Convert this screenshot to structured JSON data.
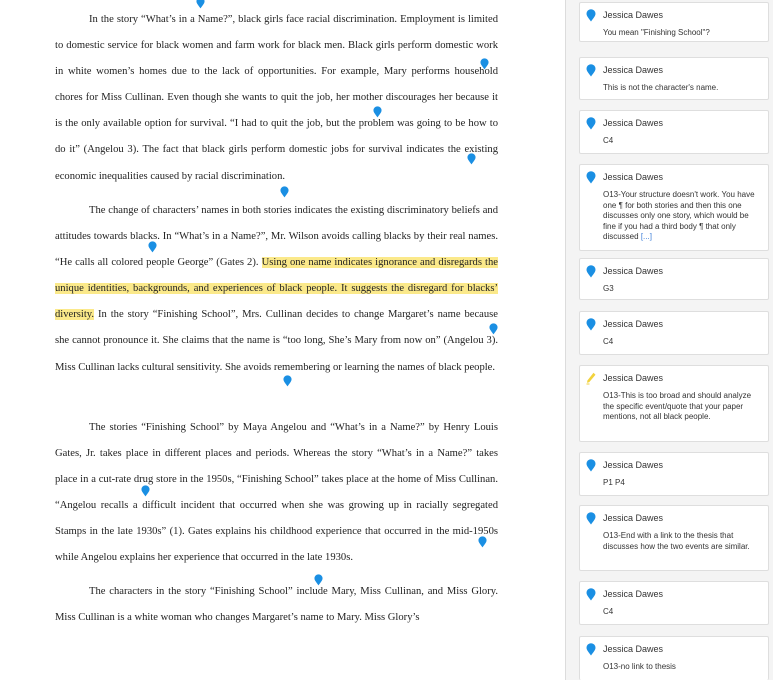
{
  "document": {
    "paragraphs": [
      {
        "text": "In the story “What’s in a Name?”, black girls face racial discrimination. Employment is limited to domestic service for black women and farm work for black men. Black girls perform domestic work in white women’s homes due to the lack of opportunities. For example, Mary performs household chores for Miss Cullinan. Even though she wants to quit the job, her mother discourages her because it is the only available option for survival. “I had to quit the job, but the problem was going to be how to do it” (Angelou 3). The fact that black girls perform domestic jobs for survival indicates the existing economic inequalities caused by racial discrimination."
      },
      {
        "before": "The change of characters’ names in both stories indicates the existing discriminatory beliefs and attitudes towards blacks. In “What’s in a Name?”, Mr. Wilson avoids calling blacks by their real names. “He calls all colored people George” (Gates 2).",
        "highlight": "Using one name indicates ignorance and disregards the unique identities, backgrounds, and experiences of black people. It suggests the disregard for blacks’ diversity.",
        "after": "In the story “Finishing School”, Mrs. Cullinan decides to change Margaret’s name because she cannot pronounce it. She claims that the name is “too long, She’s Mary from now on” (Angelou 3). Miss Cullinan lacks cultural sensitivity. She avoids remembering or learning the names of black people."
      },
      {
        "text": "The stories “Finishing School” by Maya Angelou and “What’s in a Name?” by Henry Louis Gates, Jr. takes place in different places and periods. Whereas the story “What’s in a Name?” takes place in a cut-rate drug store in the 1950s, “Finishing School” takes place at the home of Miss Cullinan. “Angelou recalls a difficult incident that occurred when she was growing up in racially segregated Stamps in the late 1930s” (1). Gates explains his childhood experience that occurred in the mid-1950s while Angelou explains her experience that occurred in the late 1930s."
      },
      {
        "text": "The characters in the story “Finishing School” include Mary, Miss Cullinan, and Miss Glory. Miss Cullinan is a white woman who changes Margaret’s name to Mary. Miss Glory’s"
      }
    ]
  },
  "comments": [
    {
      "author": "Jessica Dawes",
      "text": "You mean \"Finishing School\"?",
      "more": ""
    },
    {
      "author": "Jessica Dawes",
      "text": "This is not the character's name.",
      "more": ""
    },
    {
      "author": "Jessica Dawes",
      "text": "C4",
      "more": ""
    },
    {
      "author": "Jessica Dawes",
      "text": "O13-Your structure doesn't work. You have one ¶ for both stories and then this one discusses only one story, which would be fine if you had a third body ¶ that only discussed",
      "more": "[...]"
    },
    {
      "author": "Jessica Dawes",
      "text": "G3",
      "more": ""
    },
    {
      "author": "Jessica Dawes",
      "text": "C4",
      "more": ""
    },
    {
      "author": "Jessica Dawes",
      "text": "O13-This is too broad and should analyze the specific event/quote that your paper mentions, not all black people.",
      "more": ""
    },
    {
      "author": "Jessica Dawes",
      "text": "P1 P4",
      "more": ""
    },
    {
      "author": "Jessica Dawes",
      "text": "O13-End with a link to the thesis that discusses how the two events are similar.",
      "more": ""
    },
    {
      "author": "Jessica Dawes",
      "text": "C4",
      "more": ""
    },
    {
      "author": "Jessica Dawes",
      "text": "O13-no link to thesis",
      "more": ""
    }
  ],
  "icons": {
    "pin": "comment-pin-icon",
    "highlighter": "highlighter-icon"
  },
  "colors": {
    "pin": "#1a8fe3",
    "highlight": "#fbe98a",
    "highlighter": "#f2d23c",
    "link": "#3b7dd8"
  }
}
